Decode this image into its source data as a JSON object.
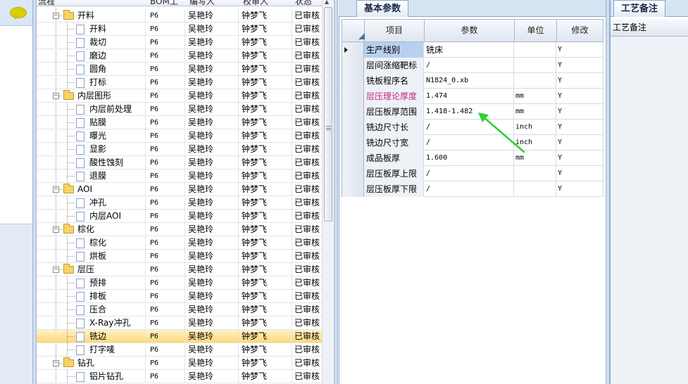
{
  "tree": {
    "columns": [
      "流程",
      "BOM工",
      "编写人",
      "校审人",
      "状态"
    ],
    "rows": [
      {
        "name": "开料",
        "level": 0,
        "type": "folder",
        "bom": "P6",
        "editor": "吴艳玲",
        "checker": "钟梦飞",
        "status": "已审核"
      },
      {
        "name": "开料",
        "level": 1,
        "type": "doc",
        "bom": "P6",
        "editor": "吴艳玲",
        "checker": "钟梦飞",
        "status": "已审核"
      },
      {
        "name": "裁切",
        "level": 1,
        "type": "doc",
        "bom": "P6",
        "editor": "吴艳玲",
        "checker": "钟梦飞",
        "status": "已审核"
      },
      {
        "name": "磨边",
        "level": 1,
        "type": "doc",
        "bom": "P6",
        "editor": "吴艳玲",
        "checker": "钟梦飞",
        "status": "已审核"
      },
      {
        "name": "圆角",
        "level": 1,
        "type": "doc",
        "bom": "P6",
        "editor": "吴艳玲",
        "checker": "钟梦飞",
        "status": "已审核"
      },
      {
        "name": "打标",
        "level": 1,
        "type": "doc",
        "bom": "P6",
        "editor": "吴艳玲",
        "checker": "钟梦飞",
        "status": "已审核"
      },
      {
        "name": "内层图形",
        "level": 0,
        "type": "folder",
        "bom": "P6",
        "editor": "吴艳玲",
        "checker": "钟梦飞",
        "status": "已审核"
      },
      {
        "name": "内层前处理",
        "level": 1,
        "type": "doc",
        "bom": "P6",
        "editor": "吴艳玲",
        "checker": "钟梦飞",
        "status": "已审核"
      },
      {
        "name": "贴膜",
        "level": 1,
        "type": "doc",
        "bom": "P6",
        "editor": "吴艳玲",
        "checker": "钟梦飞",
        "status": "已审核"
      },
      {
        "name": "曝光",
        "level": 1,
        "type": "doc",
        "bom": "P6",
        "editor": "吴艳玲",
        "checker": "钟梦飞",
        "status": "已审核"
      },
      {
        "name": "显影",
        "level": 1,
        "type": "doc",
        "bom": "P6",
        "editor": "吴艳玲",
        "checker": "钟梦飞",
        "status": "已审核"
      },
      {
        "name": "酸性蚀刻",
        "level": 1,
        "type": "doc",
        "bom": "P6",
        "editor": "吴艳玲",
        "checker": "钟梦飞",
        "status": "已审核"
      },
      {
        "name": "退膜",
        "level": 1,
        "type": "doc",
        "bom": "P6",
        "editor": "吴艳玲",
        "checker": "钟梦飞",
        "status": "已审核"
      },
      {
        "name": "AOI",
        "level": 0,
        "type": "folder",
        "bom": "P6",
        "editor": "吴艳玲",
        "checker": "钟梦飞",
        "status": "已审核"
      },
      {
        "name": "冲孔",
        "level": 1,
        "type": "doc",
        "bom": "P6",
        "editor": "吴艳玲",
        "checker": "钟梦飞",
        "status": "已审核"
      },
      {
        "name": "内层AOI",
        "level": 1,
        "type": "doc",
        "bom": "P6",
        "editor": "吴艳玲",
        "checker": "钟梦飞",
        "status": "已审核"
      },
      {
        "name": "棕化",
        "level": 0,
        "type": "folder",
        "bom": "P6",
        "editor": "吴艳玲",
        "checker": "钟梦飞",
        "status": "已审核"
      },
      {
        "name": "棕化",
        "level": 1,
        "type": "doc",
        "bom": "P6",
        "editor": "吴艳玲",
        "checker": "钟梦飞",
        "status": "已审核"
      },
      {
        "name": "烘板",
        "level": 1,
        "type": "doc",
        "bom": "P6",
        "editor": "吴艳玲",
        "checker": "钟梦飞",
        "status": "已审核"
      },
      {
        "name": "层压",
        "level": 0,
        "type": "folder",
        "bom": "P6",
        "editor": "吴艳玲",
        "checker": "钟梦飞",
        "status": "已审核"
      },
      {
        "name": "预排",
        "level": 1,
        "type": "doc",
        "bom": "P6",
        "editor": "吴艳玲",
        "checker": "钟梦飞",
        "status": "已审核"
      },
      {
        "name": "排板",
        "level": 1,
        "type": "doc",
        "bom": "P6",
        "editor": "吴艳玲",
        "checker": "钟梦飞",
        "status": "已审核"
      },
      {
        "name": "压合",
        "level": 1,
        "type": "doc",
        "bom": "P6",
        "editor": "吴艳玲",
        "checker": "钟梦飞",
        "status": "已审核"
      },
      {
        "name": "X-Ray冲孔",
        "level": 1,
        "type": "doc",
        "bom": "P6",
        "editor": "吴艳玲",
        "checker": "钟梦飞",
        "status": "已审核"
      },
      {
        "name": "铣边",
        "level": 1,
        "type": "doc",
        "bom": "P6",
        "editor": "吴艳玲",
        "checker": "钟梦飞",
        "status": "已审核",
        "selected": true
      },
      {
        "name": "打字唛",
        "level": 1,
        "type": "doc",
        "bom": "P6",
        "editor": "吴艳玲",
        "checker": "钟梦飞",
        "status": "已审核"
      },
      {
        "name": "钻孔",
        "level": 0,
        "type": "folder",
        "bom": "P6",
        "editor": "吴艳玲",
        "checker": "钟梦飞",
        "status": "已审核"
      },
      {
        "name": "铝片钻孔",
        "level": 1,
        "type": "doc",
        "bom": "P6",
        "editor": "吴艳玲",
        "checker": "钟梦飞",
        "status": "已审核"
      }
    ]
  },
  "middle": {
    "tab_label": "基本参数",
    "columns": [
      "项目",
      "参数",
      "单位",
      "修改"
    ],
    "rows": [
      {
        "item": "生产线别",
        "param": "铣床",
        "unit": "",
        "mod": "Y"
      },
      {
        "item": "层间涨缩靶标",
        "param": "/",
        "unit": "",
        "mod": "Y"
      },
      {
        "item": "铣板程序名",
        "param": "N1824_0.xb",
        "unit": "",
        "mod": "Y"
      },
      {
        "item": "层压理论厚度",
        "param": "1.474",
        "unit": "mm",
        "mod": "Y",
        "highlight": true
      },
      {
        "item": "层压板厚范围",
        "param": "1.418-1.482",
        "unit": "mm",
        "mod": "Y"
      },
      {
        "item": "铣边尺寸长",
        "param": "/",
        "unit": "inch",
        "mod": "Y"
      },
      {
        "item": "铣边尺寸宽",
        "param": "/",
        "unit": "inch",
        "mod": "Y"
      },
      {
        "item": "成品板厚",
        "param": "1.600",
        "unit": "mm",
        "mod": "Y"
      },
      {
        "item": "层压板厚上限",
        "param": "/",
        "unit": "",
        "mod": "Y"
      },
      {
        "item": "层压板厚下限",
        "param": "/",
        "unit": "",
        "mod": "Y"
      }
    ]
  },
  "right": {
    "tab_label": "工艺备注",
    "column_label": "工艺备注"
  },
  "icons": {
    "left_strip": "speech-bubble-icon",
    "folder": "folder-icon",
    "document": "document-icon",
    "annotation": "green-arrow-annotation"
  },
  "colors": {
    "selection": "#ffd877",
    "highlight_text": "#c0287e",
    "arrow": "#2fd12f",
    "header_blue": "#d6e3f3"
  }
}
